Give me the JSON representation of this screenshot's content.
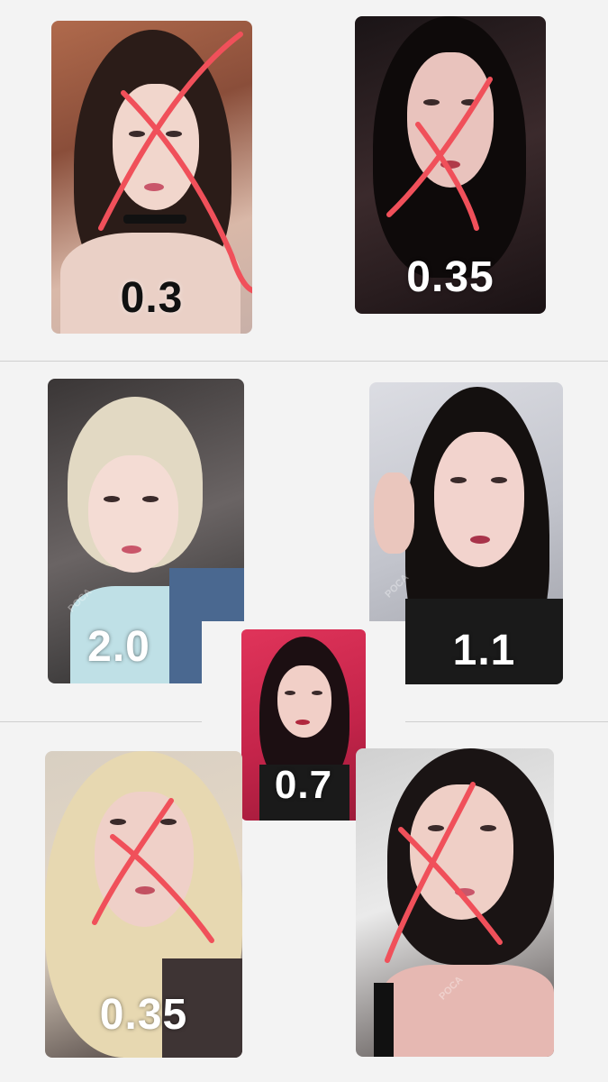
{
  "cards": [
    {
      "id": "card-1",
      "price": "0.3",
      "crossed": true
    },
    {
      "id": "card-2",
      "price": "0.35",
      "crossed": true
    },
    {
      "id": "card-3",
      "price": "2.0",
      "crossed": false
    },
    {
      "id": "card-4",
      "price": "1.1",
      "crossed": false
    },
    {
      "id": "card-5",
      "price": "0.7",
      "crossed": false
    },
    {
      "id": "card-6",
      "price": "0.35",
      "crossed": true
    },
    {
      "id": "card-7",
      "price": "",
      "crossed": true
    }
  ],
  "watermark": "POCA",
  "colors": {
    "background": "#f3f3f3",
    "cross": "#f0505a",
    "divider": "#cfcfcf"
  }
}
